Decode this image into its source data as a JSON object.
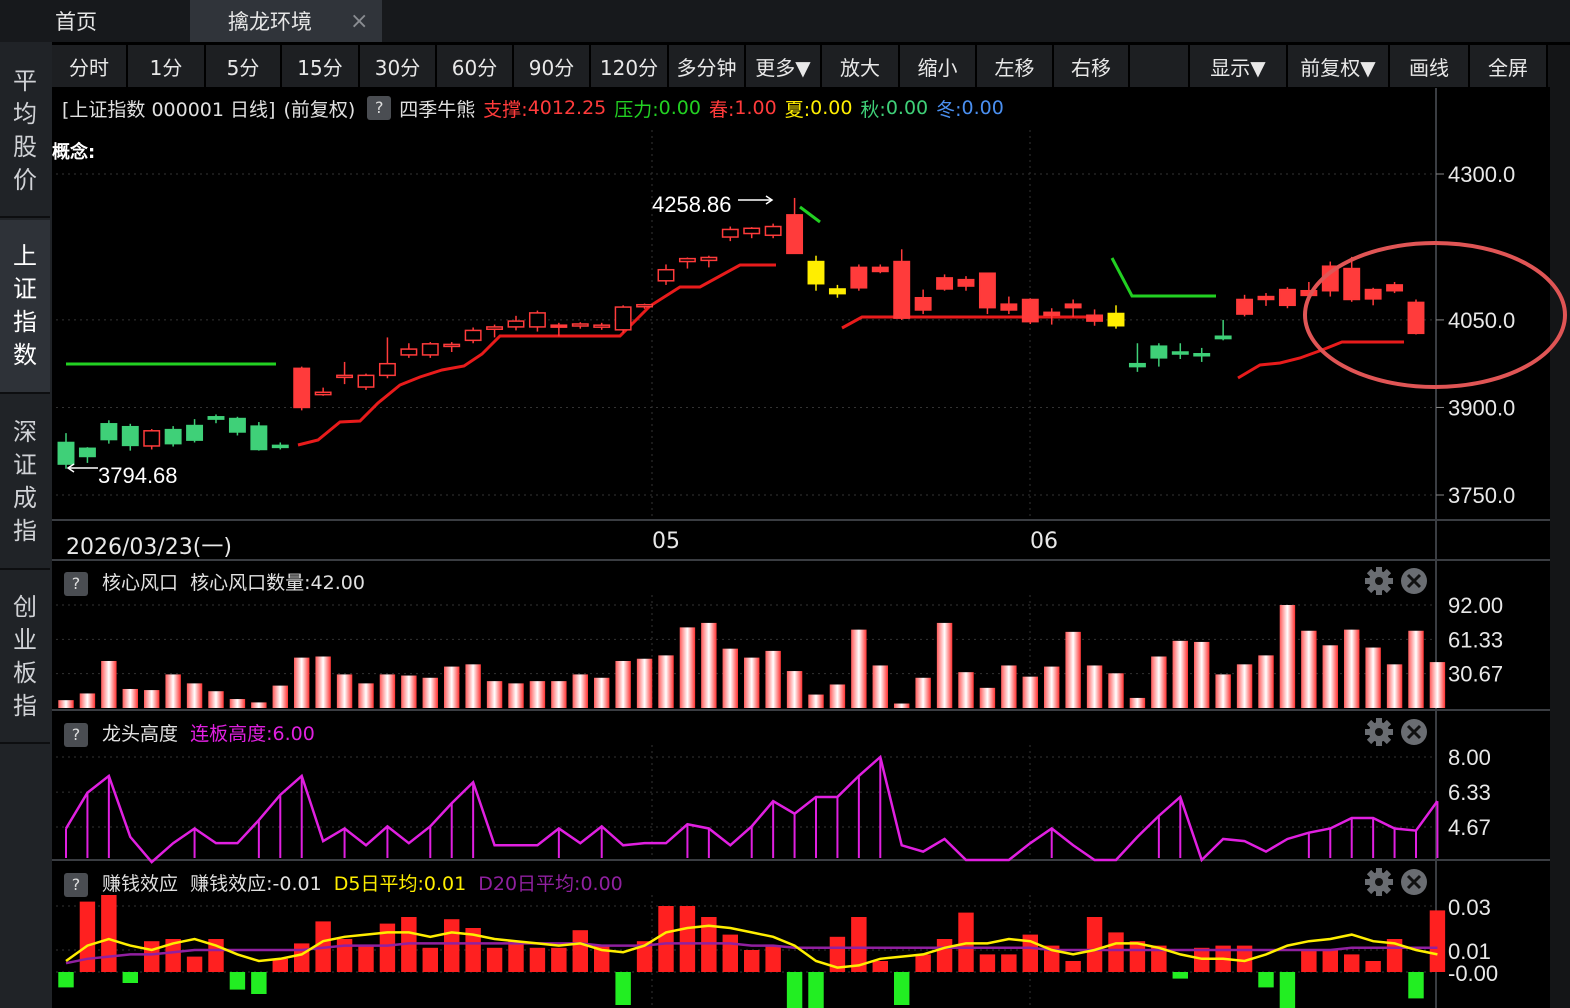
{
  "tabs": {
    "home": "首页",
    "env": "擒龙环境",
    "close_glyph": "×"
  },
  "sidebar": [
    {
      "label": "平均股价",
      "active": false
    },
    {
      "label": "上证指数",
      "active": true
    },
    {
      "label": "深证成指",
      "active": false
    },
    {
      "label": "创业板指",
      "active": false
    }
  ],
  "toolbar": [
    "分时",
    "1分",
    "5分",
    "15分",
    "30分",
    "60分",
    "90分",
    "120分",
    "多分钟",
    "更多▼",
    "放大",
    "缩小",
    "左移",
    "右移",
    "",
    "显示▼",
    "前复权▼",
    "画线",
    "全屏"
  ],
  "info": {
    "title": "[上证指数 000001 日线]",
    "adjust": "(前复权)",
    "help": "?",
    "indicator": "四季牛熊",
    "support_label": "支撑:",
    "support_value": "4012.25",
    "pressure_label": "压力:",
    "pressure_value": "0.00",
    "spring_label": "春:",
    "spring_value": "1.00",
    "summer_label": "夏:",
    "summer_value": "0.00",
    "autumn_label": "秋:",
    "autumn_value": "0.00",
    "winter_label": "冬:",
    "winter_value": "0.00",
    "concept": "概念:"
  },
  "colors": {
    "up": "#ff3b3b",
    "down": "#3fd078",
    "yellow": "#ffee00",
    "support_line": "#e81b1b",
    "pressure_line": "#22d022",
    "magenta": "#e020e0",
    "purple": "#9020a0",
    "annotation": "#e05555"
  },
  "main_chart": {
    "high_label": "4258.86",
    "low_label": "3794.68",
    "y_ticks": [
      "4300.0",
      "4050.0",
      "3900.0",
      "3750.0"
    ],
    "date_start": "2026/03/23(一)",
    "month_labels": [
      "05",
      "06"
    ]
  },
  "panel1": {
    "help": "?",
    "title": "核心风口",
    "metric_label": "核心风口数量:",
    "metric_value": "42.00",
    "y_ticks": [
      "92.00",
      "61.33",
      "30.67"
    ]
  },
  "panel2": {
    "help": "?",
    "title": "龙头高度",
    "metric_label": "连板高度:",
    "metric_value": "6.00",
    "y_ticks": [
      "8.00",
      "6.33",
      "4.67"
    ]
  },
  "panel3": {
    "help": "?",
    "title": "赚钱效应",
    "metric_label": "赚钱效应:",
    "metric_value": "-0.01",
    "d5_label": "D5日平均:",
    "d5_value": "0.01",
    "d20_label": "D20日平均:",
    "d20_value": "0.00",
    "y_ticks": [
      "0.03",
      "0.01",
      "-0.00"
    ]
  },
  "chart_data": [
    {
      "type": "candlestick",
      "title": "[上证指数 000001 日线]",
      "yticks": [
        4300,
        4050,
        3900,
        3750
      ],
      "candles": [
        {
          "o": 3840,
          "h": 3856,
          "l": 3795,
          "c": 3803,
          "color": "down"
        },
        {
          "o": 3830,
          "h": 3832,
          "l": 3805,
          "c": 3816,
          "color": "down"
        },
        {
          "o": 3872,
          "h": 3878,
          "l": 3838,
          "c": 3845,
          "color": "down"
        },
        {
          "o": 3867,
          "h": 3872,
          "l": 3826,
          "c": 3835,
          "color": "down"
        },
        {
          "o": 3834,
          "h": 3863,
          "l": 3828,
          "c": 3860,
          "color": "up"
        },
        {
          "o": 3862,
          "h": 3868,
          "l": 3833,
          "c": 3838,
          "color": "down"
        },
        {
          "o": 3869,
          "h": 3880,
          "l": 3840,
          "c": 3844,
          "color": "down"
        },
        {
          "o": 3884,
          "h": 3888,
          "l": 3873,
          "c": 3880,
          "color": "down"
        },
        {
          "o": 3881,
          "h": 3884,
          "l": 3852,
          "c": 3858,
          "color": "down"
        },
        {
          "o": 3868,
          "h": 3875,
          "l": 3826,
          "c": 3828,
          "color": "down"
        },
        {
          "o": 3835,
          "h": 3840,
          "l": 3828,
          "c": 3833,
          "color": "down"
        },
        {
          "o": 3900,
          "h": 3970,
          "l": 3895,
          "c": 3967,
          "color": "up"
        },
        {
          "o": 3922,
          "h": 3934,
          "l": 3920,
          "c": 3926,
          "color": "up"
        },
        {
          "o": 3953,
          "h": 3978,
          "l": 3940,
          "c": 3955,
          "color": "up"
        },
        {
          "o": 3935,
          "h": 3958,
          "l": 3930,
          "c": 3955,
          "color": "up"
        },
        {
          "o": 3955,
          "h": 4020,
          "l": 3950,
          "c": 3975,
          "color": "up"
        },
        {
          "o": 3990,
          "h": 4010,
          "l": 3985,
          "c": 4000,
          "color": "up"
        },
        {
          "o": 3990,
          "h": 4012,
          "l": 3985,
          "c": 4009,
          "color": "up"
        },
        {
          "o": 4005,
          "h": 4012,
          "l": 3995,
          "c": 4008,
          "color": "up"
        },
        {
          "o": 4015,
          "h": 4037,
          "l": 4010,
          "c": 4032,
          "color": "up"
        },
        {
          "o": 4034,
          "h": 4042,
          "l": 4020,
          "c": 4038,
          "color": "up"
        },
        {
          "o": 4038,
          "h": 4057,
          "l": 4032,
          "c": 4048,
          "color": "up"
        },
        {
          "o": 4038,
          "h": 4066,
          "l": 4030,
          "c": 4062,
          "color": "up"
        },
        {
          "o": 4041,
          "h": 4045,
          "l": 4022,
          "c": 4039,
          "color": "up"
        },
        {
          "o": 4040,
          "h": 4046,
          "l": 4035,
          "c": 4043,
          "color": "up"
        },
        {
          "o": 4040,
          "h": 4045,
          "l": 4033,
          "c": 4041,
          "color": "up"
        },
        {
          "o": 4033,
          "h": 4075,
          "l": 4028,
          "c": 4072,
          "color": "up"
        },
        {
          "o": 4073,
          "h": 4078,
          "l": 4069,
          "c": 4076,
          "color": "up"
        },
        {
          "o": 4117,
          "h": 4145,
          "l": 4110,
          "c": 4136,
          "color": "up"
        },
        {
          "o": 4150,
          "h": 4157,
          "l": 4138,
          "c": 4155,
          "color": "up"
        },
        {
          "o": 4152,
          "h": 4160,
          "l": 4140,
          "c": 4157,
          "color": "up"
        },
        {
          "o": 4192,
          "h": 4210,
          "l": 4185,
          "c": 4205,
          "color": "up"
        },
        {
          "o": 4198,
          "h": 4209,
          "l": 4190,
          "c": 4207,
          "color": "up"
        },
        {
          "o": 4195,
          "h": 4215,
          "l": 4190,
          "c": 4210,
          "color": "up"
        },
        {
          "o": 4230,
          "h": 4259,
          "l": 4164,
          "c": 4164,
          "color": "up"
        },
        {
          "o": 4150,
          "h": 4160,
          "l": 4100,
          "c": 4112,
          "color": "yellow"
        },
        {
          "o": 4095,
          "h": 4110,
          "l": 4088,
          "c": 4103,
          "color": "yellow"
        },
        {
          "o": 4105,
          "h": 4145,
          "l": 4100,
          "c": 4140,
          "color": "up"
        },
        {
          "o": 4140,
          "h": 4145,
          "l": 4130,
          "c": 4133,
          "color": "up"
        },
        {
          "o": 4150,
          "h": 4171,
          "l": 4050,
          "c": 4053,
          "color": "up"
        },
        {
          "o": 4088,
          "h": 4102,
          "l": 4060,
          "c": 4067,
          "color": "up"
        },
        {
          "o": 4103,
          "h": 4128,
          "l": 4100,
          "c": 4122,
          "color": "up"
        },
        {
          "o": 4108,
          "h": 4125,
          "l": 4100,
          "c": 4119,
          "color": "up"
        },
        {
          "o": 4130,
          "h": 4131,
          "l": 4060,
          "c": 4071,
          "color": "up"
        },
        {
          "o": 4077,
          "h": 4090,
          "l": 4060,
          "c": 4067,
          "color": "up"
        },
        {
          "o": 4085,
          "h": 4087,
          "l": 4043,
          "c": 4047,
          "color": "up"
        },
        {
          "o": 4063,
          "h": 4070,
          "l": 4042,
          "c": 4058,
          "color": "up"
        },
        {
          "o": 4071,
          "h": 4085,
          "l": 4055,
          "c": 4077,
          "color": "up"
        },
        {
          "o": 4058,
          "h": 4068,
          "l": 4040,
          "c": 4048,
          "color": "up"
        },
        {
          "o": 4040,
          "h": 4075,
          "l": 4035,
          "c": 4061,
          "color": "yellow"
        },
        {
          "o": 3970,
          "h": 4010,
          "l": 3961,
          "c": 3975,
          "color": "down"
        },
        {
          "o": 4005,
          "h": 4010,
          "l": 3970,
          "c": 3985,
          "color": "down"
        },
        {
          "o": 3995,
          "h": 4010,
          "l": 3983,
          "c": 3992,
          "color": "down"
        },
        {
          "o": 3992,
          "h": 4002,
          "l": 3978,
          "c": 3990,
          "color": "down"
        },
        {
          "o": 4018,
          "h": 4050,
          "l": 4015,
          "c": 4022,
          "color": "down"
        },
        {
          "o": 4060,
          "h": 4093,
          "l": 4056,
          "c": 4085,
          "color": "up"
        },
        {
          "o": 4085,
          "h": 4096,
          "l": 4074,
          "c": 4090,
          "color": "up"
        },
        {
          "o": 4075,
          "h": 4106,
          "l": 4070,
          "c": 4102,
          "color": "up"
        },
        {
          "o": 4100,
          "h": 4115,
          "l": 4085,
          "c": 4092,
          "color": "up"
        },
        {
          "o": 4100,
          "h": 4150,
          "l": 4090,
          "c": 4142,
          "color": "up"
        },
        {
          "o": 4138,
          "h": 4158,
          "l": 4081,
          "c": 4085,
          "color": "up"
        },
        {
          "o": 4086,
          "h": 4105,
          "l": 4075,
          "c": 4102,
          "color": "up"
        },
        {
          "o": 4100,
          "h": 4115,
          "l": 4096,
          "c": 4110,
          "color": "up"
        },
        {
          "o": 4080,
          "h": 4085,
          "l": 4025,
          "c": 4027,
          "color": "up"
        }
      ]
    },
    {
      "type": "bar",
      "title": "核心风口",
      "yticks": [
        92,
        61.33,
        30.67
      ],
      "values": [
        7,
        13,
        42,
        17,
        16,
        30,
        22,
        15,
        8,
        5,
        20,
        45,
        46,
        30,
        22,
        30,
        29,
        27,
        37,
        39,
        24,
        22,
        24,
        24,
        30,
        27,
        42,
        44,
        47,
        72,
        76,
        53,
        45,
        51,
        33,
        12,
        21,
        70,
        38,
        4,
        27,
        76,
        32,
        18,
        38,
        28,
        37,
        68,
        38,
        31,
        9,
        46,
        60,
        59,
        30,
        39,
        47,
        92,
        69,
        56,
        70,
        54,
        39,
        69,
        41
      ]
    },
    {
      "type": "line",
      "title": "龙头高度",
      "yticks": [
        8,
        6.33,
        4.67
      ],
      "values": [
        4.6,
        6.3,
        7.1,
        4.2,
        3,
        3.9,
        4.6,
        3.9,
        3.9,
        5,
        6.2,
        7.1,
        4,
        4.6,
        3.8,
        4.7,
        3.9,
        4.7,
        5.8,
        6.8,
        3.8,
        3.8,
        3.8,
        4.6,
        3.9,
        4.7,
        3.8,
        3.9,
        3.9,
        4.8,
        4.6,
        3.8,
        4.7,
        5.9,
        5.3,
        6.1,
        6.1,
        7.1,
        8,
        3.8,
        3.5,
        4.1,
        3.1,
        3.1,
        3.1,
        3.9,
        4.6,
        3.8,
        3.1,
        3.1,
        4.2,
        5.2,
        6.1,
        3.1,
        4.1,
        4,
        3.5,
        4.1,
        4.4,
        4.6,
        5.1,
        5.1,
        4.6,
        4.5,
        5.9
      ]
    },
    {
      "type": "bar",
      "title": "赚钱效应",
      "yticks": [
        0.03,
        0.01,
        -0.0
      ],
      "values": [
        -0.007,
        0.032,
        0.035,
        -0.005,
        0.014,
        0.015,
        0.007,
        0.015,
        -0.008,
        -0.01,
        0.006,
        0.013,
        0.023,
        0.015,
        0.012,
        0.022,
        0.025,
        0.011,
        0.024,
        0.02,
        0.011,
        0.014,
        0.011,
        0.011,
        0.019,
        0.012,
        -0.015,
        0.014,
        0.03,
        0.03,
        0.025,
        0.017,
        0.01,
        0.012,
        -0.018,
        -0.02,
        0.016,
        0.025,
        0.005,
        -0.015,
        0.008,
        0.015,
        0.027,
        0.008,
        0.008,
        0.017,
        0.012,
        0.005,
        0.025,
        0.018,
        0.014,
        0.012,
        -0.003,
        0.011,
        0.012,
        0.012,
        -0.007,
        -0.02,
        0.01,
        0.01,
        0.008,
        0.005,
        0.015,
        -0.012,
        0.028
      ],
      "d5": [
        0.005,
        0.012,
        0.015,
        0.012,
        0.01,
        0.013,
        0.015,
        0.012,
        0.008,
        0.005,
        0.006,
        0.008,
        0.014,
        0.016,
        0.017,
        0.018,
        0.018,
        0.016,
        0.018,
        0.017,
        0.015,
        0.014,
        0.013,
        0.012,
        0.013,
        0.01,
        0.009,
        0.012,
        0.018,
        0.02,
        0.021,
        0.02,
        0.018,
        0.016,
        0.012,
        0.005,
        0.002,
        0.003,
        0.006,
        0.007,
        0.008,
        0.011,
        0.013,
        0.013,
        0.015,
        0.014,
        0.01,
        0.008,
        0.01,
        0.013,
        0.013,
        0.011,
        0.008,
        0.006,
        0.006,
        0.005,
        0.008,
        0.012,
        0.014,
        0.015,
        0.017,
        0.014,
        0.013,
        0.01,
        0.008
      ],
      "d20": [
        0.004,
        0.006,
        0.007,
        0.008,
        0.008,
        0.009,
        0.01,
        0.01,
        0.01,
        0.01,
        0.01,
        0.01,
        0.011,
        0.012,
        0.012,
        0.012,
        0.013,
        0.013,
        0.013,
        0.013,
        0.013,
        0.013,
        0.013,
        0.013,
        0.013,
        0.012,
        0.012,
        0.012,
        0.013,
        0.013,
        0.013,
        0.013,
        0.012,
        0.012,
        0.011,
        0.011,
        0.011,
        0.011,
        0.011,
        0.011,
        0.011,
        0.011,
        0.011,
        0.011,
        0.011,
        0.011,
        0.01,
        0.01,
        0.01,
        0.01,
        0.01,
        0.01,
        0.01,
        0.01,
        0.01,
        0.01,
        0.01,
        0.01,
        0.01,
        0.01,
        0.011,
        0.011,
        0.011,
        0.011,
        0.011
      ]
    }
  ]
}
